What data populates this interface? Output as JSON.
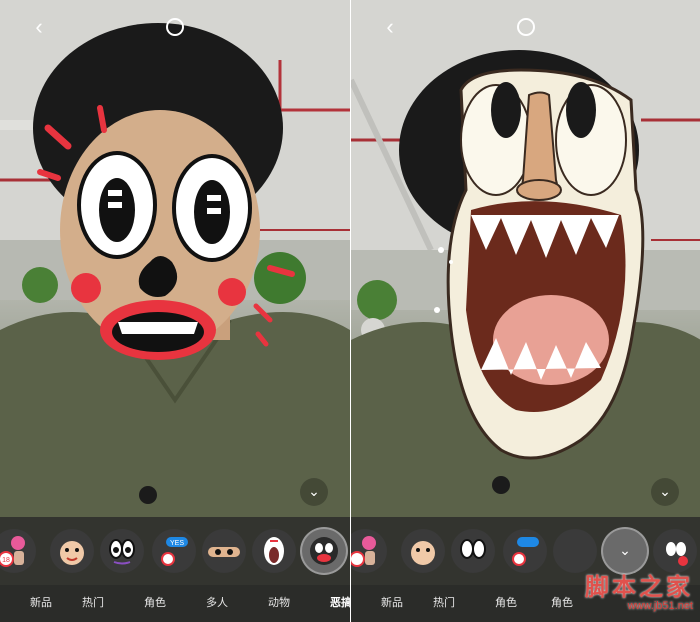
{
  "left_panel": {
    "top_bar": {
      "back_icon": "chevron-left-icon",
      "capture_icon": "circle-icon"
    },
    "collapse_icon": "chevron-down-icon",
    "stickers": [
      {
        "name": "sticker-18-plus",
        "badge": "18"
      },
      {
        "name": "sticker-cute-face",
        "badge": ""
      },
      {
        "name": "sticker-eyes",
        "badge": ""
      },
      {
        "name": "sticker-yes",
        "badge": "YES"
      },
      {
        "name": "sticker-eye-cover",
        "badge": ""
      },
      {
        "name": "sticker-scream",
        "badge": ""
      },
      {
        "name": "sticker-cartoon-face",
        "badge": ""
      }
    ],
    "categories": [
      "新品",
      "热门",
      "角色",
      "多人",
      "动物",
      "恶搞"
    ],
    "active_category": "恶搞"
  },
  "right_panel": {
    "top_bar": {
      "back_icon": "chevron-left-icon",
      "capture_icon": "circle-icon"
    },
    "collapse_icon": "chevron-down-icon",
    "categories": [
      "新品",
      "热门",
      "角色",
      "角色"
    ]
  },
  "watermark": {
    "title": "脚本之家",
    "url": "www.jb51.net"
  },
  "colors": {
    "mask_red": "#e8343f",
    "shirt": "#5b6249",
    "bar": "#2b2b2b"
  }
}
